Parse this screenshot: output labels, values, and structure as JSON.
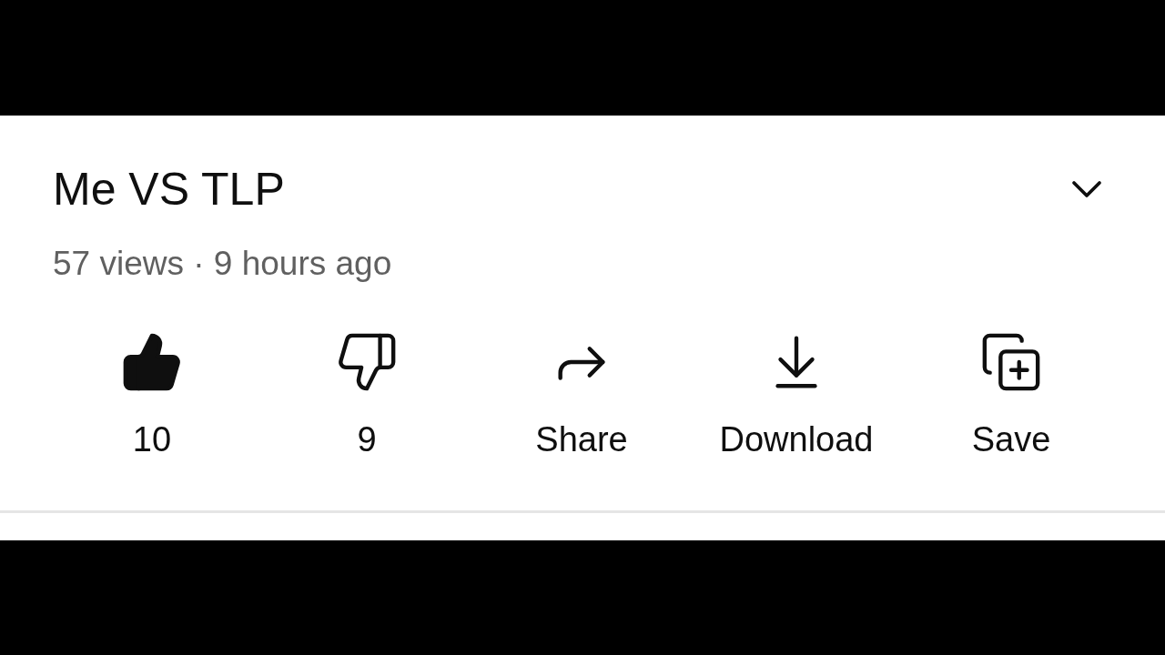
{
  "video": {
    "title": "Me VS TLP",
    "meta": "57 views · 9 hours ago"
  },
  "actions": [
    {
      "kind": "like",
      "label": "10",
      "selected": true
    },
    {
      "kind": "dislike",
      "label": "9",
      "selected": false
    },
    {
      "kind": "share",
      "label": "Share"
    },
    {
      "kind": "download",
      "label": "Download"
    },
    {
      "kind": "save",
      "label": "Save"
    }
  ]
}
